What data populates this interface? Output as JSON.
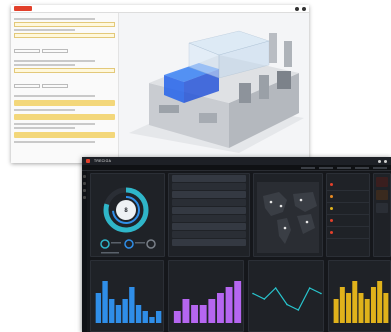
{
  "back_window": {
    "title": "",
    "colors": {
      "brand": "#e2402b",
      "highlight": "#f3d77a"
    }
  },
  "front_window": {
    "brand": "TRECIOA",
    "colors": {
      "teal": "#2fb6c9",
      "blue": "#2f8ee8",
      "violet": "#b566f0",
      "cyan": "#28c6cf",
      "gold": "#e0b21b",
      "red": "#e2402b",
      "orange": "#e88a22"
    },
    "gauge_value": "8",
    "status_items": [
      {
        "color": "#e2402b"
      },
      {
        "color": "#e88a22"
      },
      {
        "color": "#e0b21b"
      },
      {
        "color": "#e2402b"
      },
      {
        "color": "#e2402b"
      }
    ]
  },
  "chart_data": [
    {
      "type": "bar",
      "values": [
        5,
        7,
        4,
        3,
        4,
        6,
        3,
        2,
        1,
        2
      ]
    },
    {
      "type": "bar",
      "values": [
        2,
        4,
        3,
        3,
        4,
        5,
        6,
        7
      ]
    },
    {
      "type": "line",
      "values": [
        5,
        4,
        6,
        3,
        2,
        6,
        5
      ]
    },
    {
      "type": "bar",
      "values": [
        4,
        6,
        5,
        7,
        5,
        4,
        6,
        7,
        5
      ]
    }
  ]
}
